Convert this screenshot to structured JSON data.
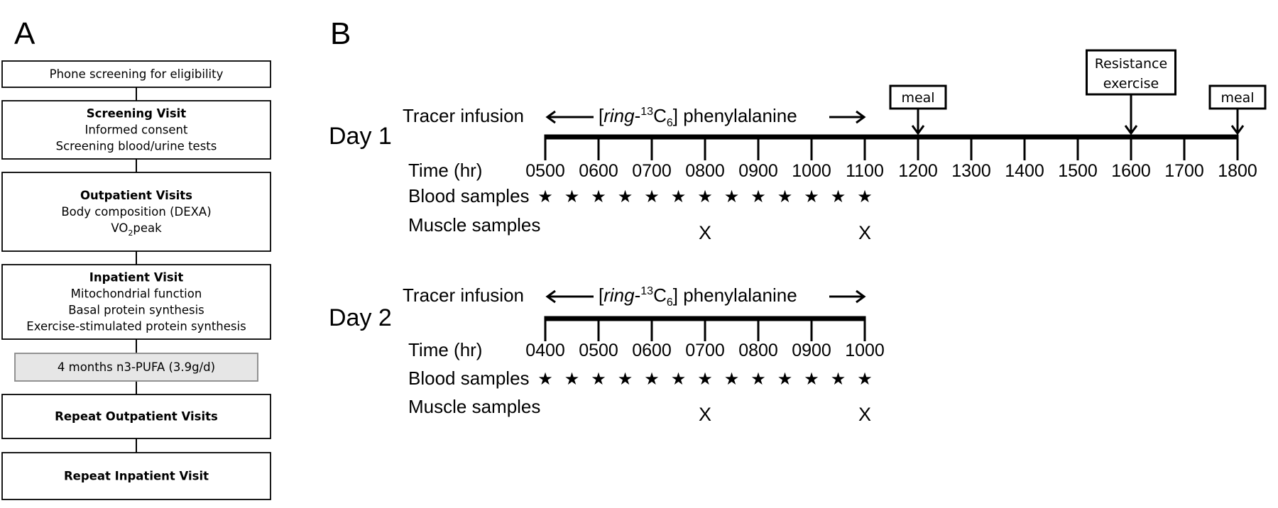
{
  "panel_a": {
    "letter": "A",
    "steps": [
      {
        "title": "",
        "lines": [
          "Phone screening for eligibility"
        ],
        "style": "plain"
      },
      {
        "title": "Screening Visit",
        "lines": [
          "Informed consent",
          "Screening blood/urine tests"
        ],
        "style": "plain"
      },
      {
        "title": "Outpatient Visits",
        "lines": [
          "Body composition (DEXA)",
          "VO2peak"
        ],
        "style": "plain"
      },
      {
        "title": "Inpatient Visit",
        "lines": [
          "Mitochondrial function",
          "Basal protein synthesis",
          "Exercise-stimulated protein synthesis"
        ],
        "style": "plain"
      },
      {
        "title": "",
        "lines": [
          "4 months n3-PUFA (3.9g/d)"
        ],
        "style": "shaded"
      },
      {
        "title": "Repeat Outpatient Visits",
        "lines": [],
        "style": "plain"
      },
      {
        "title": "Repeat Inpatient Visit",
        "lines": [],
        "style": "plain"
      }
    ],
    "shaded_fill": "#e6e6e6",
    "shaded_border": "#888888"
  },
  "panel_b": {
    "letter": "B",
    "tracer_label": "Tracer infusion",
    "tracer_compound": {
      "open": "[",
      "italic": "ring",
      "dash": "-",
      "sup": "13",
      "element": "C",
      "sub": "6",
      "close": "] phenylalanine"
    },
    "time_label": "Time (hr)",
    "blood_label": "Blood samples",
    "muscle_label": "Muscle samples",
    "star_glyph": "★",
    "muscle_glyph": "X",
    "days": [
      {
        "label": "Day 1",
        "ticks": [
          "0500",
          "0600",
          "0700",
          "0800",
          "0900",
          "1000",
          "1100",
          "1200",
          "1300",
          "1400",
          "1500",
          "1600",
          "1700",
          "1800"
        ],
        "infusion_end_index": 6,
        "blood_samples": [
          "0500",
          "0530",
          "0600",
          "0630",
          "0700",
          "0730",
          "0800",
          "0830",
          "0900",
          "0930",
          "1000",
          "1030",
          "1100"
        ],
        "muscle_samples": [
          "0800",
          "1100"
        ],
        "events": [
          {
            "label_lines": [
              "meal"
            ],
            "at": "1200"
          },
          {
            "label_lines": [
              "Resistance",
              "exercise"
            ],
            "at": "1600"
          },
          {
            "label_lines": [
              "meal"
            ],
            "at": "1800"
          }
        ]
      },
      {
        "label": "Day 2",
        "ticks": [
          "0400",
          "0500",
          "0600",
          "0700",
          "0800",
          "0900",
          "1000"
        ],
        "infusion_end_index": 6,
        "blood_samples": [
          "0400",
          "0430",
          "0500",
          "0530",
          "0600",
          "0630",
          "0700",
          "0730",
          "0800",
          "0830",
          "0900",
          "0930",
          "1000"
        ],
        "muscle_samples": [
          "0700",
          "1000"
        ],
        "events": []
      }
    ]
  }
}
